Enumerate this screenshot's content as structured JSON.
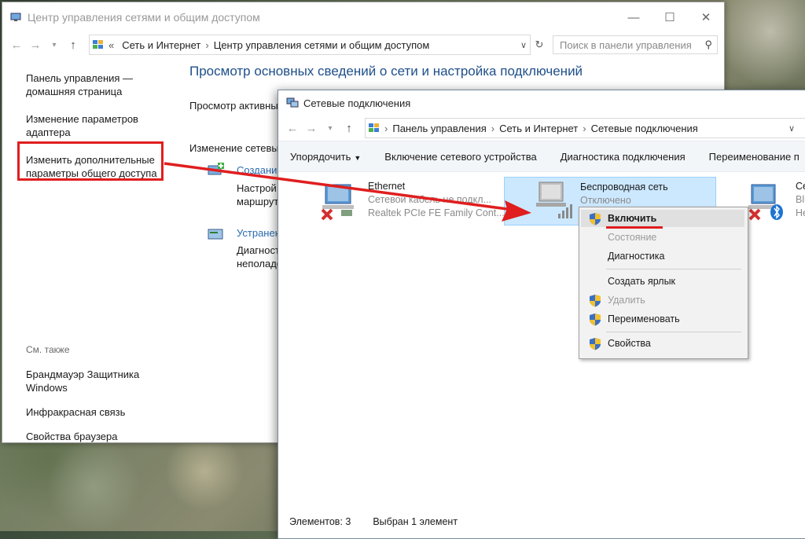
{
  "background_window": {
    "title": "Центр управления сетями и общим доступом",
    "window_controls": [
      "—",
      "☐",
      "✕"
    ],
    "breadcrumb": [
      "Сеть и Интернет",
      "Центр управления сетями и общим доступом"
    ],
    "search_placeholder": "Поиск в панели управления",
    "sidebar": {
      "links": [
        "Панель управления —\nдомашняя страница",
        "Изменение параметров\nадаптера",
        "Изменить дополнительные\nпараметры общего доступа"
      ],
      "see_also_label": "См. также",
      "see_also": [
        "Брандмауэр Защитника\nWindows",
        "Инфракрасная связь",
        "Свойства браузера"
      ]
    },
    "main": {
      "heading": "Просмотр основных сведений о сети и настройка подключений",
      "active_label": "Просмотр активны",
      "change_label": "Изменение сетевы",
      "task1_link": "Создание",
      "task1_desc_1": "Настрой",
      "task1_desc_2": "маршрут",
      "task2_link": "Устранен",
      "task2_desc_1": "Диагност",
      "task2_desc_2": "неполадо"
    }
  },
  "front_window": {
    "title": "Сетевые подключения",
    "breadcrumb": [
      "Панель управления",
      "Сеть и Интернет",
      "Сетевые подключения"
    ],
    "toolbar": [
      "Упорядочить",
      "Включение сетевого устройства",
      "Диагностика подключения",
      "Переименование п"
    ],
    "connections": [
      {
        "name": "Ethernet",
        "status": "Сетевой кабель не подкл...",
        "device": "Realtek PCIe FE Family Cont..."
      },
      {
        "name": "Беспроводная сеть",
        "status": "Отключено",
        "device": ""
      },
      {
        "name": "Се",
        "status": "Blu",
        "device": "Не"
      }
    ],
    "status_bar": {
      "count": "Элементов: 3",
      "selected": "Выбран 1 элемент"
    }
  },
  "context_menu": {
    "items": [
      {
        "label": "Включить",
        "shield": true
      },
      {
        "label": "Состояние",
        "shield": false
      },
      {
        "label": "Диагностика",
        "shield": false
      },
      {
        "label": "Создать ярлык",
        "shield": false
      },
      {
        "label": "Удалить",
        "shield": true
      },
      {
        "label": "Переименовать",
        "shield": true
      },
      {
        "label": "Свойства",
        "shield": true
      }
    ]
  },
  "colors": {
    "annotation_red": "#e01e1e",
    "selection": "#cce8ff",
    "heading_blue": "#1e4f8a"
  }
}
